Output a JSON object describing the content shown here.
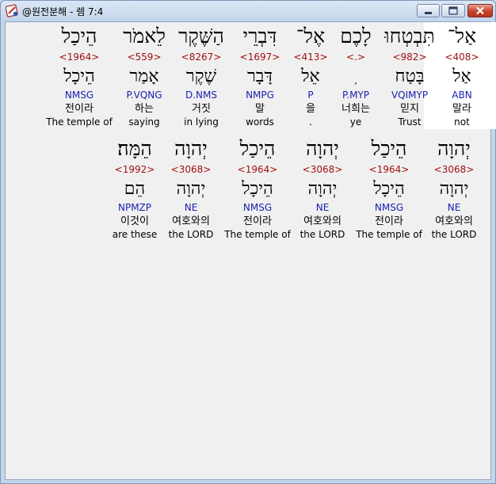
{
  "window": {
    "title": "@원전분해 - 렘 7:4"
  },
  "rows": [
    {
      "words": [
        {
          "hebrew": "אַל־",
          "strong": "<408>",
          "lemma": "אַל",
          "parse": "ABN",
          "korean": "말라",
          "english": "not",
          "selected": true
        },
        {
          "hebrew": "תִּבְטְחוּ",
          "strong": "<982>",
          "lemma": "בָּטַח",
          "parse": "VQIMYP",
          "korean": "믿지",
          "english": "Trust"
        },
        {
          "hebrew": "לָכֶם",
          "strong": "<.>",
          "lemma": "ֽ",
          "parse": "P.MYP",
          "korean": "너희는",
          "english": "ye"
        },
        {
          "hebrew": "אֶל־",
          "strong": "<413>",
          "lemma": "אֵל",
          "parse": "P",
          "korean": "을",
          "english": "."
        },
        {
          "hebrew": "דִּבְרֵי",
          "strong": "<1697>",
          "lemma": "דָּבָר",
          "parse": "NMPG",
          "korean": "말",
          "english": "words"
        },
        {
          "hebrew": "הַשֶּׁקֶר",
          "strong": "<8267>",
          "lemma": "שֶׁקֶר",
          "parse": "D.NMS",
          "korean": "거짓",
          "english": "in lying"
        },
        {
          "hebrew": "לֵאמֹר",
          "strong": "<559>",
          "lemma": "אָמַר",
          "parse": "P.VQNG",
          "korean": "하는",
          "english": "saying"
        },
        {
          "hebrew": "הֵיכַל",
          "strong": "<1964>",
          "lemma": "הֵיכָל",
          "parse": "NMSG",
          "korean": "전이라",
          "english": "The temple of"
        }
      ]
    },
    {
      "words": [
        {
          "hebrew": "יְהוָה",
          "strong": "<3068>",
          "lemma": "יְהוָה",
          "parse": "NE",
          "korean": "여호와의",
          "english": "the LORD"
        },
        {
          "hebrew": "הֵיכַל",
          "strong": "<1964>",
          "lemma": "הֵיכָל",
          "parse": "NMSG",
          "korean": "전이라",
          "english": "The temple of"
        },
        {
          "hebrew": "יְהוָה",
          "strong": "<3068>",
          "lemma": "יְהוָה",
          "parse": "NE",
          "korean": "여호와의",
          "english": "the LORD"
        },
        {
          "hebrew": "הֵיכַל",
          "strong": "<1964>",
          "lemma": "הֵיכָל",
          "parse": "NMSG",
          "korean": "전이라",
          "english": "The temple of"
        },
        {
          "hebrew": "יְהוָה",
          "strong": "<3068>",
          "lemma": "יְהוָה",
          "parse": "NE",
          "korean": "여호와의",
          "english": "the LORD"
        },
        {
          "hebrew": "הֵמָּה׃",
          "strong": "<1992>",
          "lemma": "הֵם",
          "parse": "NPMZP",
          "korean": "이것이",
          "english": "are these"
        }
      ]
    }
  ],
  "colors": {
    "strong_number": "#a11010",
    "parse_code": "#1a1fb0",
    "selected_background": "#ffffff"
  }
}
